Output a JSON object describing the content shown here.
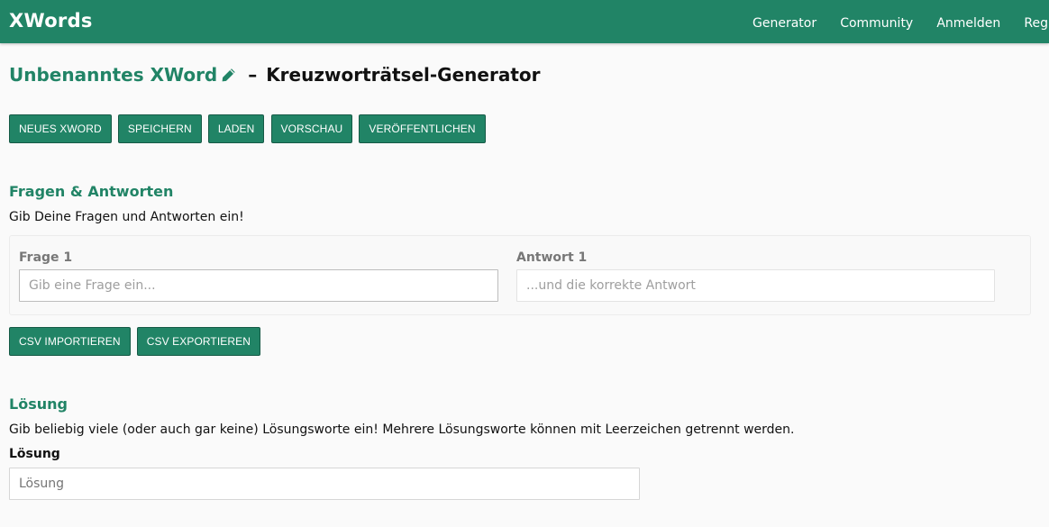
{
  "header": {
    "brand": "XWords",
    "nav": [
      {
        "label": "Generator"
      },
      {
        "label": "Community"
      },
      {
        "label": "Anmelden"
      },
      {
        "label": "Registrieren"
      }
    ]
  },
  "title": {
    "doc_name": "Unbenanntes XWord",
    "separator": "–",
    "subtitle": "Kreuzworträtsel-Generator",
    "edit_icon": "pencil-icon"
  },
  "toolbar": {
    "new": "Neues XWord",
    "save": "Speichern",
    "load": "Laden",
    "preview": "Vorschau",
    "publish": "Veröffentlichen"
  },
  "qa_section": {
    "title": "Fragen & Antworten",
    "description": "Gib Deine Fragen und Antworten ein!",
    "rows": [
      {
        "question_label": "Frage 1",
        "question_placeholder": "Gib eine Frage ein...",
        "question_value": "",
        "answer_label": "Antwort 1",
        "answer_placeholder": "...und die korrekte Antwort",
        "answer_value": ""
      }
    ],
    "csv_import": "CSV importieren",
    "csv_export": "CSV exportieren"
  },
  "solution_section": {
    "title": "Lösung",
    "description": "Gib beliebig viele (oder auch gar keine) Lösungsworte ein! Mehrere Lösungsworte können mit Leerzeichen getrennt werden.",
    "label": "Lösung",
    "placeholder": "Lösung",
    "value": ""
  },
  "colors": {
    "brand": "#218466",
    "background": "#fafafa"
  }
}
